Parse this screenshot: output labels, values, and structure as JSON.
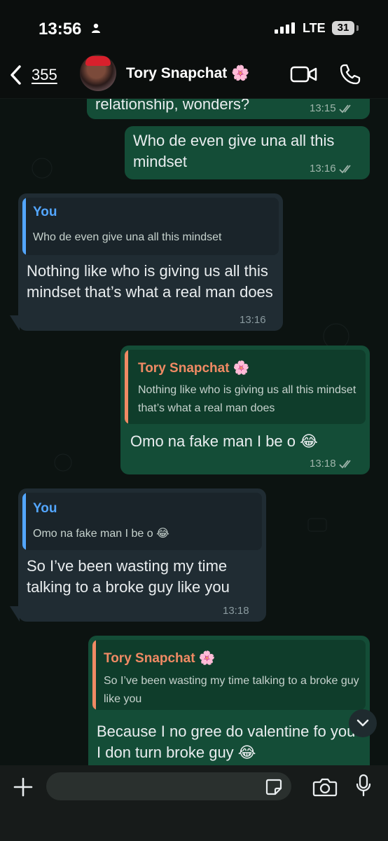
{
  "status_bar": {
    "time": "13:56",
    "network": "LTE",
    "battery": "31"
  },
  "header": {
    "back_count": "355",
    "contact_name": "Tory Snapchat 🌸"
  },
  "messages": [
    {
      "direction": "out",
      "text": "relationship, wonders?",
      "time": "13:15"
    },
    {
      "direction": "out",
      "text": "Who de even give una all this mindset",
      "time": "13:16"
    },
    {
      "direction": "in",
      "quote_author": "You",
      "quote_text": "Who de even give una all this mindset",
      "text": "Nothing like who is giving us all this mindset that’s what a real man does",
      "time": "13:16"
    },
    {
      "direction": "out",
      "quote_author": "Tory Snapchat 🌸",
      "quote_text": "Nothing like who is giving us all this mindset that’s what a real man does",
      "text": "Omo na fake man I be o 😂",
      "time": "13:18"
    },
    {
      "direction": "in",
      "quote_author": "You",
      "quote_text": "Omo na fake man I be o 😂",
      "text": "So I’ve been wasting my time talking to a broke guy like you",
      "time": "13:18"
    },
    {
      "direction": "out",
      "quote_author": "Tory Snapchat 🌸",
      "quote_text": "So I’ve been wasting my time talking to a broke guy like you",
      "text": "Because I no gree do valentine fo you I don turn broke guy 😂"
    }
  ],
  "input": {
    "placeholder": ""
  },
  "colors": {
    "outgoing_bubble": "#144d37",
    "incoming_bubble": "#202c33",
    "quote_you": "#53a6ff",
    "quote_contact": "#f08a64"
  }
}
